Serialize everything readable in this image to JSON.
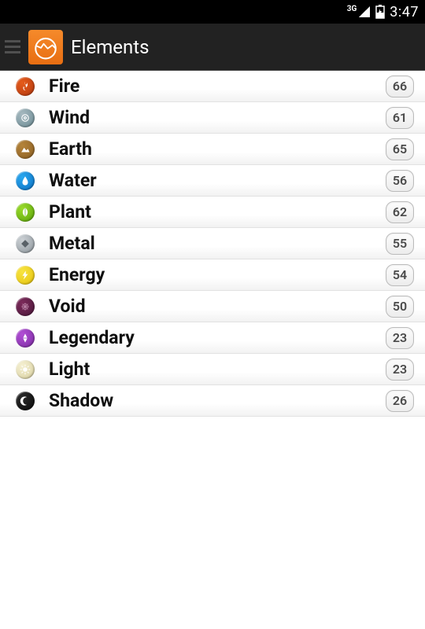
{
  "status": {
    "network": "3G",
    "time": "3:47"
  },
  "header": {
    "title": "Elements"
  },
  "elements": [
    {
      "iconName": "fire-icon",
      "label": "Fire",
      "count": "66",
      "gradient": [
        "#e55b1a",
        "#b33810"
      ],
      "glyphColor": "#fff"
    },
    {
      "iconName": "wind-icon",
      "label": "Wind",
      "count": "61",
      "gradient": [
        "#a6b9c0",
        "#6a8a92"
      ],
      "glyphColor": "#fff"
    },
    {
      "iconName": "earth-icon",
      "label": "Earth",
      "count": "65",
      "gradient": [
        "#b5843a",
        "#8a5e22"
      ],
      "glyphColor": "#fff"
    },
    {
      "iconName": "water-icon",
      "label": "Water",
      "count": "56",
      "gradient": [
        "#2aa8ef",
        "#0a6fc2"
      ],
      "glyphColor": "#fff"
    },
    {
      "iconName": "plant-icon",
      "label": "Plant",
      "count": "62",
      "gradient": [
        "#9adb2a",
        "#58a208"
      ],
      "glyphColor": "#fff"
    },
    {
      "iconName": "metal-icon",
      "label": "Metal",
      "count": "55",
      "gradient": [
        "#cdd2d6",
        "#8a9399"
      ],
      "glyphColor": "#5a6268"
    },
    {
      "iconName": "energy-icon",
      "label": "Energy",
      "count": "54",
      "gradient": [
        "#f7e441",
        "#e6c20a"
      ],
      "glyphColor": "#fff"
    },
    {
      "iconName": "void-icon",
      "label": "Void",
      "count": "50",
      "gradient": [
        "#7c2a5a",
        "#4a173a"
      ],
      "glyphColor": "#bb84a7"
    },
    {
      "iconName": "legendary-icon",
      "label": "Legendary",
      "count": "23",
      "gradient": [
        "#b24fd6",
        "#7a2aa0"
      ],
      "glyphColor": "#fff"
    },
    {
      "iconName": "light-icon",
      "label": "Light",
      "count": "23",
      "gradient": [
        "#f5f0d2",
        "#d8cf9e"
      ],
      "glyphColor": "#fff"
    },
    {
      "iconName": "shadow-icon",
      "label": "Shadow",
      "count": "26",
      "gradient": [
        "#2a2a2a",
        "#0a0a0a"
      ],
      "glyphColor": "#fff"
    }
  ]
}
